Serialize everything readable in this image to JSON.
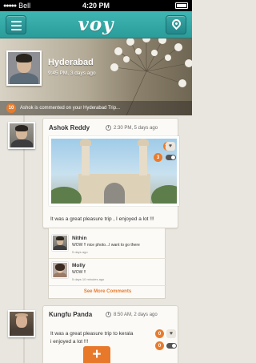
{
  "status_bar": {
    "carrier": "Bell",
    "time": "4:20 PM"
  },
  "nav": {
    "logo": "voy",
    "menu_icon": "menu-icon",
    "location_icon": "map-pin-icon"
  },
  "hero": {
    "title": "Hyderabad",
    "meta": "9:45 PM, 3 days ago",
    "notification_count": "10",
    "notification_text": "Ashok is commented on your Hyderabad Trip..."
  },
  "posts": [
    {
      "author": "Ashok Reddy",
      "time": "2:30 PM, 5 days ago",
      "likes": "10",
      "comments": "3",
      "text": "It was a great pleasure trip , I enjoyed a lot !!!",
      "comments_list": [
        {
          "name": "Nithin",
          "text": "WOW !! nice photo...I want to go there",
          "time": "5 days ago"
        },
        {
          "name": "Molly",
          "text": "WOW !!",
          "time": "5 days 10 minutes ago"
        }
      ],
      "see_more": "See More Comments"
    },
    {
      "author": "Kungfu Panda",
      "time": "8:50 AM, 2 days ago",
      "likes": "0",
      "comments": "0",
      "text_line1": "It was a great pleasure trip to kerala",
      "text_line2": "i enjoyed a lot !!!"
    }
  ],
  "fab": {
    "label": "+"
  },
  "colors": {
    "teal": "#3fb6b3",
    "orange": "#e87c2c",
    "background": "#e9e6df"
  }
}
